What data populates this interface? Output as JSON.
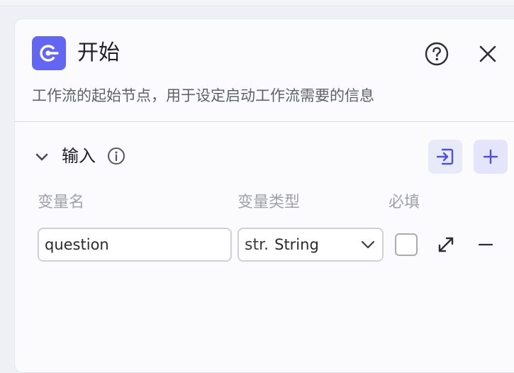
{
  "node": {
    "title": "开始",
    "description": "工作流的起始节点，用于设定启动工作流需要的信息",
    "icon": "start-node-icon",
    "accent_color": "#6366f1"
  },
  "header_actions": {
    "help_icon": "help-circle-icon",
    "close_icon": "close-icon"
  },
  "inputs_section": {
    "title": "输入",
    "info_icon": "info-icon",
    "collapse_icon": "chevron-down-icon",
    "import_icon": "import-icon",
    "add_icon": "plus-icon",
    "columns": {
      "name": "变量名",
      "type": "变量类型",
      "required": "必填"
    },
    "rows": [
      {
        "name": "question",
        "type_prefix": "str.",
        "type": "String",
        "required": false
      }
    ]
  }
}
